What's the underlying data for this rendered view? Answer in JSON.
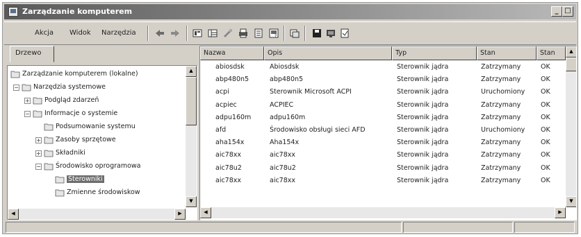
{
  "window": {
    "title": "Zarządzanie komputerem"
  },
  "titlebar_buttons": [
    "_",
    "□",
    "×"
  ],
  "menu": [
    "Akcja",
    "Widok",
    "Narzędzia"
  ],
  "toolbar_icons": [
    "back-arrow-icon",
    "forward-arrow-icon",
    "up-folder-icon",
    "show-tree-icon",
    "properties-icon",
    "print-icon",
    "export-list-icon",
    "help-icon",
    "refresh-icon",
    "console-icon",
    "connect-icon",
    "monitor-icon"
  ],
  "tab": {
    "label": "Drzewo"
  },
  "tree": [
    {
      "label": "Zarządzanie komputerem (lokalne)",
      "level": 0,
      "expander": "",
      "icon": "computer-icon"
    },
    {
      "label": "Narzędzia systemowe",
      "level": 1,
      "expander": "−",
      "icon": "tools-icon"
    },
    {
      "label": "Podgląd zdarzeń",
      "level": 2,
      "expander": "+",
      "icon": "event-viewer-icon"
    },
    {
      "label": "Informacje o systemie",
      "level": 2,
      "expander": "−",
      "icon": "system-info-icon"
    },
    {
      "label": "Podsumowanie systemu",
      "level": 3,
      "expander": "",
      "icon": "folder-icon"
    },
    {
      "label": "Zasoby sprzętowe",
      "level": 3,
      "expander": "+",
      "icon": "folder-icon"
    },
    {
      "label": "Składniki",
      "level": 3,
      "expander": "+",
      "icon": "folder-icon"
    },
    {
      "label": "Środowisko oprogramowa",
      "level": 3,
      "expander": "−",
      "icon": "folder-icon"
    },
    {
      "label": "Sterowniki",
      "level": 4,
      "expander": "",
      "icon": "folder-icon",
      "selected": true
    },
    {
      "label": "Zmienne środowiskow",
      "level": 4,
      "expander": "",
      "icon": "folder-icon"
    }
  ],
  "columns": [
    "Nazwa",
    "Opis",
    "Typ",
    "Stan",
    "Stan"
  ],
  "rows": [
    [
      "abiosdsk",
      "Abiosdsk",
      "Sterownik jądra",
      "Zatrzymany",
      "OK"
    ],
    [
      "abp480n5",
      "abp480n5",
      "Sterownik jądra",
      "Zatrzymany",
      "OK"
    ],
    [
      "acpi",
      "Sterownik Microsoft ACPI",
      "Sterownik jądra",
      "Uruchomiony",
      "OK"
    ],
    [
      "acpiec",
      "ACPIEC",
      "Sterownik jądra",
      "Zatrzymany",
      "OK"
    ],
    [
      "adpu160m",
      "adpu160m",
      "Sterownik jądra",
      "Zatrzymany",
      "OK"
    ],
    [
      "afd",
      "Środowisko obsługi sieci AFD",
      "Sterownik jądra",
      "Uruchomiony",
      "OK"
    ],
    [
      "aha154x",
      "Aha154x",
      "Sterownik jądra",
      "Zatrzymany",
      "OK"
    ],
    [
      "aic78xx",
      "aic78xx",
      "Sterownik jądra",
      "Zatrzymany",
      "OK"
    ],
    [
      "aic78u2",
      "aic78u2",
      "Sterownik jądra",
      "Zatrzymany",
      "OK"
    ],
    [
      "aic78xx",
      "aic78xx",
      "Sterownik jądra",
      "Zatrzymany",
      "OK"
    ]
  ]
}
